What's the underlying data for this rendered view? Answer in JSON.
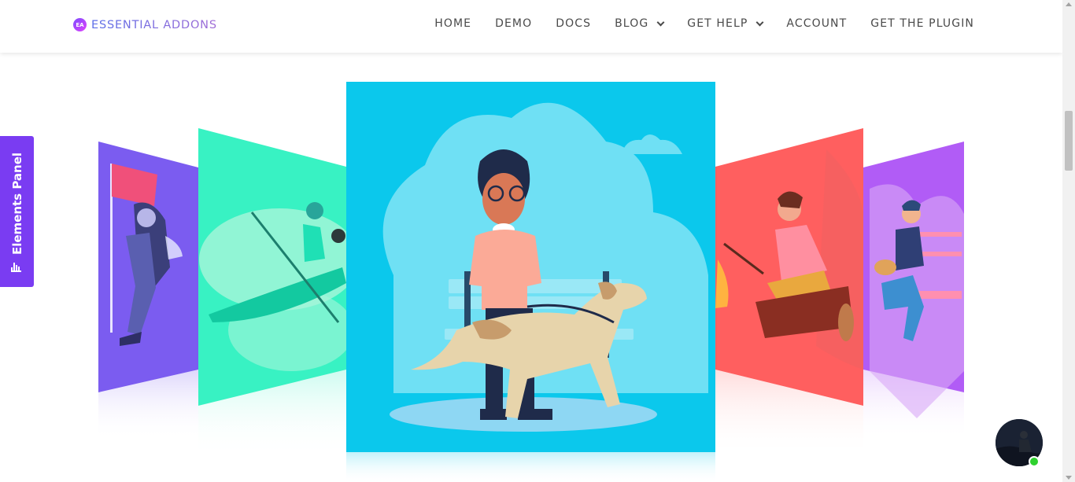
{
  "brand": {
    "name": "ESSENTIAL ADDONS",
    "mark": "EA"
  },
  "nav": {
    "items": [
      {
        "label": "HOME",
        "dropdown": false
      },
      {
        "label": "DEMO",
        "dropdown": false
      },
      {
        "label": "DOCS",
        "dropdown": false
      },
      {
        "label": "BLOG",
        "dropdown": true
      },
      {
        "label": "GET HELP",
        "dropdown": true
      },
      {
        "label": "ACCOUNT",
        "dropdown": false
      },
      {
        "label": "GET THE PLUGIN",
        "dropdown": false
      }
    ]
  },
  "side_panel": {
    "label": "Elements Panel",
    "icon": "bar-chart-icon"
  },
  "coverflow": {
    "slides": [
      {
        "name": "hiker-flag",
        "bg": "#7b5cf0"
      },
      {
        "name": "kayaker",
        "bg": "#38f2c3"
      },
      {
        "name": "boy-with-dog",
        "bg": "#0bc8ec",
        "active": true
      },
      {
        "name": "campfire-marshmallow",
        "bg": "#ff5f5f"
      },
      {
        "name": "guitar-player",
        "bg": "#b15cf6"
      }
    ]
  },
  "chat": {
    "icon": "chat-avatar-icon",
    "status": "online",
    "status_color": "#2ed12e"
  },
  "colors": {
    "accent": "#7a3cf2",
    "nav_text": "#4a4a4a"
  }
}
